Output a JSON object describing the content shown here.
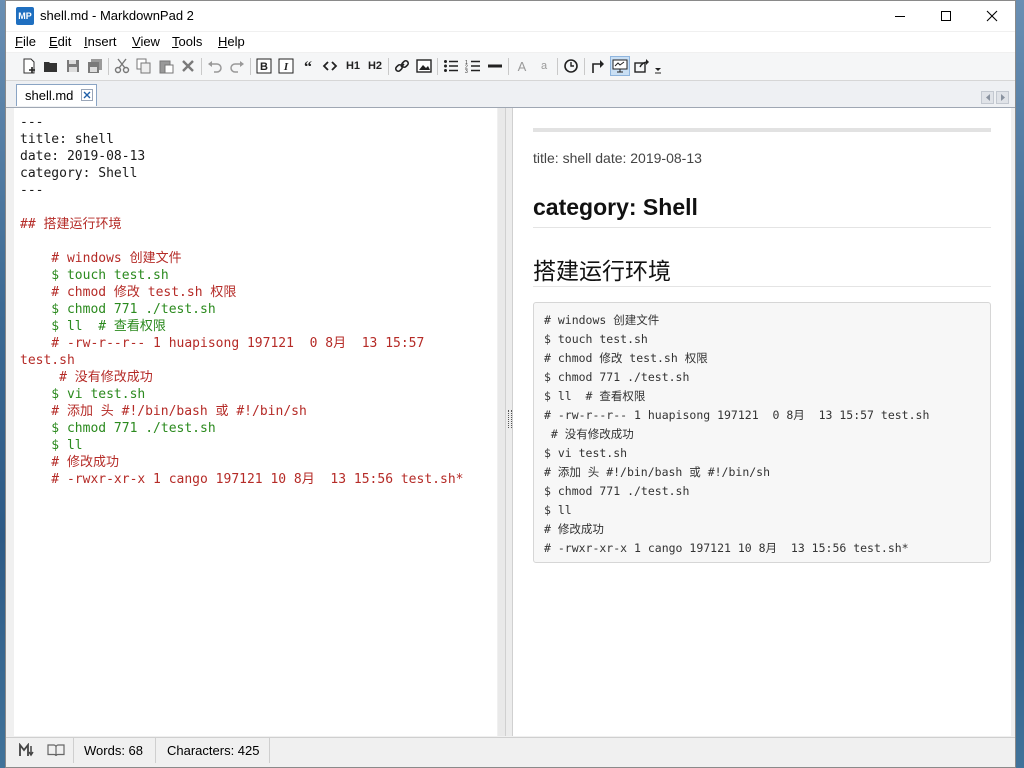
{
  "window": {
    "app_icon_text": "MP",
    "title": "shell.md - MarkdownPad 2"
  },
  "menu": {
    "items": [
      {
        "accel": "F",
        "rest": "ile"
      },
      {
        "accel": "E",
        "rest": "dit"
      },
      {
        "accel": "I",
        "rest": "nsert"
      },
      {
        "accel": "V",
        "rest": "iew"
      },
      {
        "accel": "T",
        "rest": "ools"
      },
      {
        "accel": "H",
        "rest": "elp"
      }
    ]
  },
  "toolbar": {
    "h1_label": "H1",
    "h2_label": "H2",
    "font_large_label": "A",
    "font_small_label": "a",
    "icons": [
      "new-file-icon",
      "open-folder-icon",
      "save-icon",
      "save-all-icon",
      "cut-icon",
      "copy-icon",
      "paste-icon",
      "delete-icon",
      "undo-icon",
      "redo-icon",
      "bold-icon",
      "italic-icon",
      "quote-icon",
      "code-icon",
      "h1-icon",
      "h2-icon",
      "link-icon",
      "image-icon",
      "bullet-list-icon",
      "numbered-list-icon",
      "horizontal-rule-icon",
      "increase-font-icon",
      "decrease-font-icon",
      "timestamp-icon",
      "export-icon",
      "preview-icon",
      "share-icon",
      "toolbar-options-icon"
    ]
  },
  "tab": {
    "label": "shell.md"
  },
  "editor": {
    "lines": [
      {
        "text": "---",
        "color": "black"
      },
      {
        "text": "title: shell",
        "color": "black"
      },
      {
        "text": "date: 2019-08-13",
        "color": "black"
      },
      {
        "text": "category: Shell",
        "color": "black"
      },
      {
        "text": "---",
        "color": "black"
      },
      {
        "text": "",
        "color": "black"
      },
      {
        "text": "## 搭建运行环境",
        "color": "red"
      },
      {
        "text": "",
        "color": "black"
      },
      {
        "text": "    # windows 创建文件",
        "color": "red"
      },
      {
        "text": "    $ touch test.sh",
        "color": "green"
      },
      {
        "text": "    # chmod 修改 test.sh 权限",
        "color": "red"
      },
      {
        "text": "    $ chmod 771 ./test.sh",
        "color": "green"
      },
      {
        "text": "    $ ll  # 查看权限",
        "color": "green"
      },
      {
        "text": "    # -rw-r--r-- 1 huapisong 197121  0 8月  13 15:57",
        "color": "red"
      },
      {
        "text": "test.sh",
        "color": "red"
      },
      {
        "text": "     # 没有修改成功",
        "color": "red"
      },
      {
        "text": "    $ vi test.sh",
        "color": "green"
      },
      {
        "text": "    # 添加 头 #!/bin/bash 或 #!/bin/sh",
        "color": "red"
      },
      {
        "text": "    $ chmod 771 ./test.sh",
        "color": "green"
      },
      {
        "text": "    $ ll",
        "color": "green"
      },
      {
        "text": "    # 修改成功",
        "color": "red"
      },
      {
        "text": "    # -rwxr-xr-x 1 cango 197121 10 8月  13 15:56 test.sh*",
        "color": "red"
      }
    ]
  },
  "preview": {
    "meta": "title: shell date: 2019-08-13",
    "heading_category": "category: Shell",
    "heading_env": "搭建运行环境",
    "code_lines": [
      "# windows 创建文件",
      "$ touch test.sh",
      "# chmod 修改 test.sh 权限",
      "$ chmod 771 ./test.sh",
      "$ ll  # 查看权限",
      "# -rw-r--r-- 1 huapisong 197121  0 8月  13 15:57 test.sh",
      " # 没有修改成功",
      "$ vi test.sh",
      "# 添加 头 #!/bin/bash 或 #!/bin/sh",
      "$ chmod 771 ./test.sh",
      "$ ll",
      "# 修改成功",
      "# -rwxr-xr-x 1 cango 197121 10 8月  13 15:56 test.sh*"
    ]
  },
  "status": {
    "words": "Words: 68",
    "characters": "Characters: 425"
  },
  "colors": {
    "accent": "#1f6fc0",
    "editor_red": "#b52b27",
    "editor_green": "#2b8a1e"
  }
}
